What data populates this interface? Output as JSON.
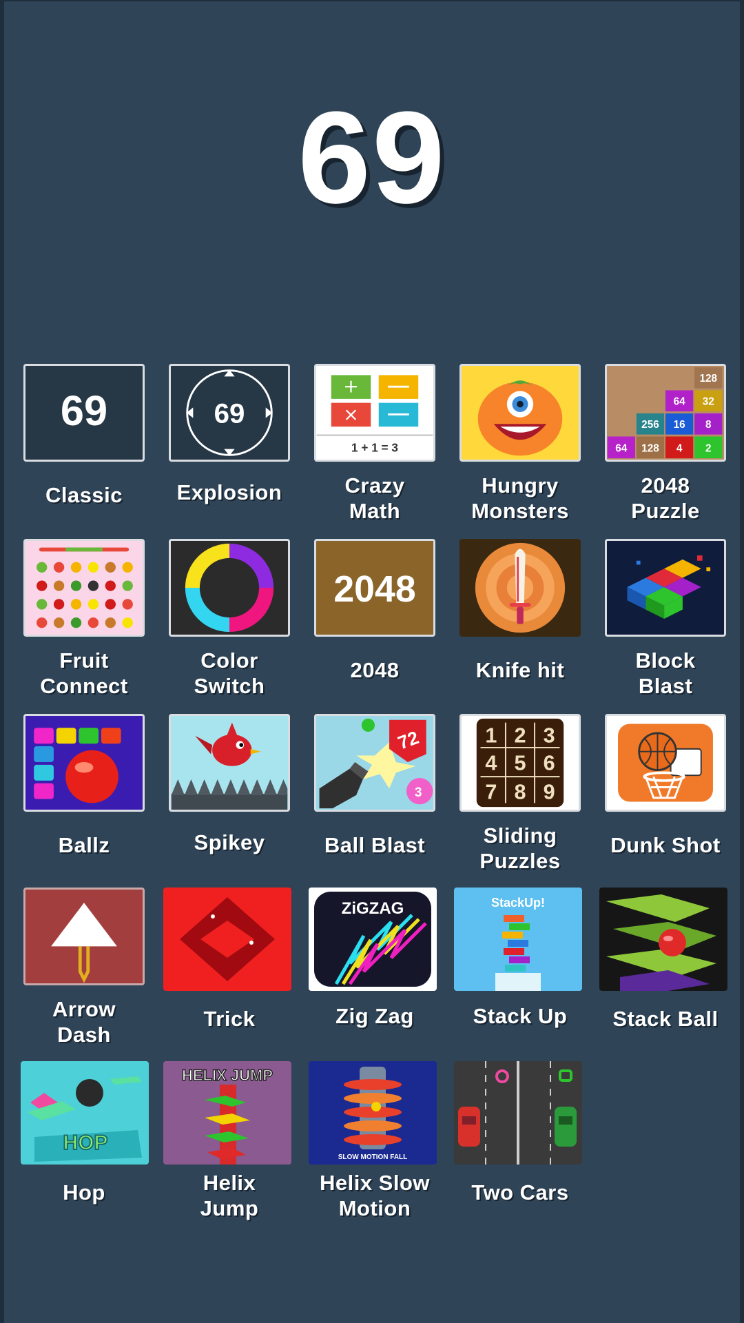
{
  "score": "69",
  "games": [
    {
      "label": "Classic",
      "icon": "classic-69-icon"
    },
    {
      "label": "Explosion",
      "icon": "explosion-69-icon"
    },
    {
      "label": "Crazy\nMath",
      "icon": "crazy-math-icon"
    },
    {
      "label": "Hungry\nMonsters",
      "icon": "hungry-monster-icon"
    },
    {
      "label": "2048\nPuzzle",
      "icon": "2048-puzzle-icon"
    },
    {
      "label": "Fruit\nConnect",
      "icon": "fruit-connect-icon"
    },
    {
      "label": "Color\nSwitch",
      "icon": "color-switch-icon"
    },
    {
      "label": "2048",
      "icon": "2048-icon"
    },
    {
      "label": "Knife hit",
      "icon": "knife-hit-icon"
    },
    {
      "label": "Block\nBlast",
      "icon": "block-blast-icon"
    },
    {
      "label": "Ballz",
      "icon": "ballz-icon"
    },
    {
      "label": "Spikey",
      "icon": "spikey-bird-icon"
    },
    {
      "label": "Ball Blast",
      "icon": "ball-blast-icon"
    },
    {
      "label": "Sliding\nPuzzles",
      "icon": "sliding-puzzle-icon"
    },
    {
      "label": "Dunk Shot",
      "icon": "dunk-shot-icon"
    },
    {
      "label": "Arrow\nDash",
      "icon": "arrow-dash-icon"
    },
    {
      "label": "Trick",
      "icon": "trick-icon"
    },
    {
      "label": "Zig Zag",
      "icon": "zigzag-icon"
    },
    {
      "label": "Stack Up",
      "icon": "stack-up-icon"
    },
    {
      "label": "Stack Ball",
      "icon": "stack-ball-icon"
    },
    {
      "label": "Hop",
      "icon": "hop-icon"
    },
    {
      "label": "Helix\nJump",
      "icon": "helix-jump-icon"
    },
    {
      "label": "Helix Slow\nMotion",
      "icon": "helix-slow-motion-icon"
    },
    {
      "label": "Two Cars",
      "icon": "two-cars-icon"
    }
  ],
  "icon_text": {
    "classic": "69",
    "explosion": "69",
    "crazy_math_eq": "1 + 1 = 3",
    "puzzle2048_cells": [
      "128",
      "64",
      "32",
      "256",
      "16",
      "8",
      "64",
      "128",
      "4",
      "2"
    ],
    "g2048": "2048",
    "ball_blast_nums": [
      "72",
      "3"
    ],
    "sliding_nums": [
      "1",
      "2",
      "3",
      "4",
      "5",
      "6",
      "7",
      "8",
      "9"
    ],
    "zigzag": "ZiGZAG",
    "stackup": "StackUp!",
    "hop": "HOP",
    "helix_jump": "HELIX JUMP",
    "helix_slow": "SLOW MOTION FALL"
  }
}
